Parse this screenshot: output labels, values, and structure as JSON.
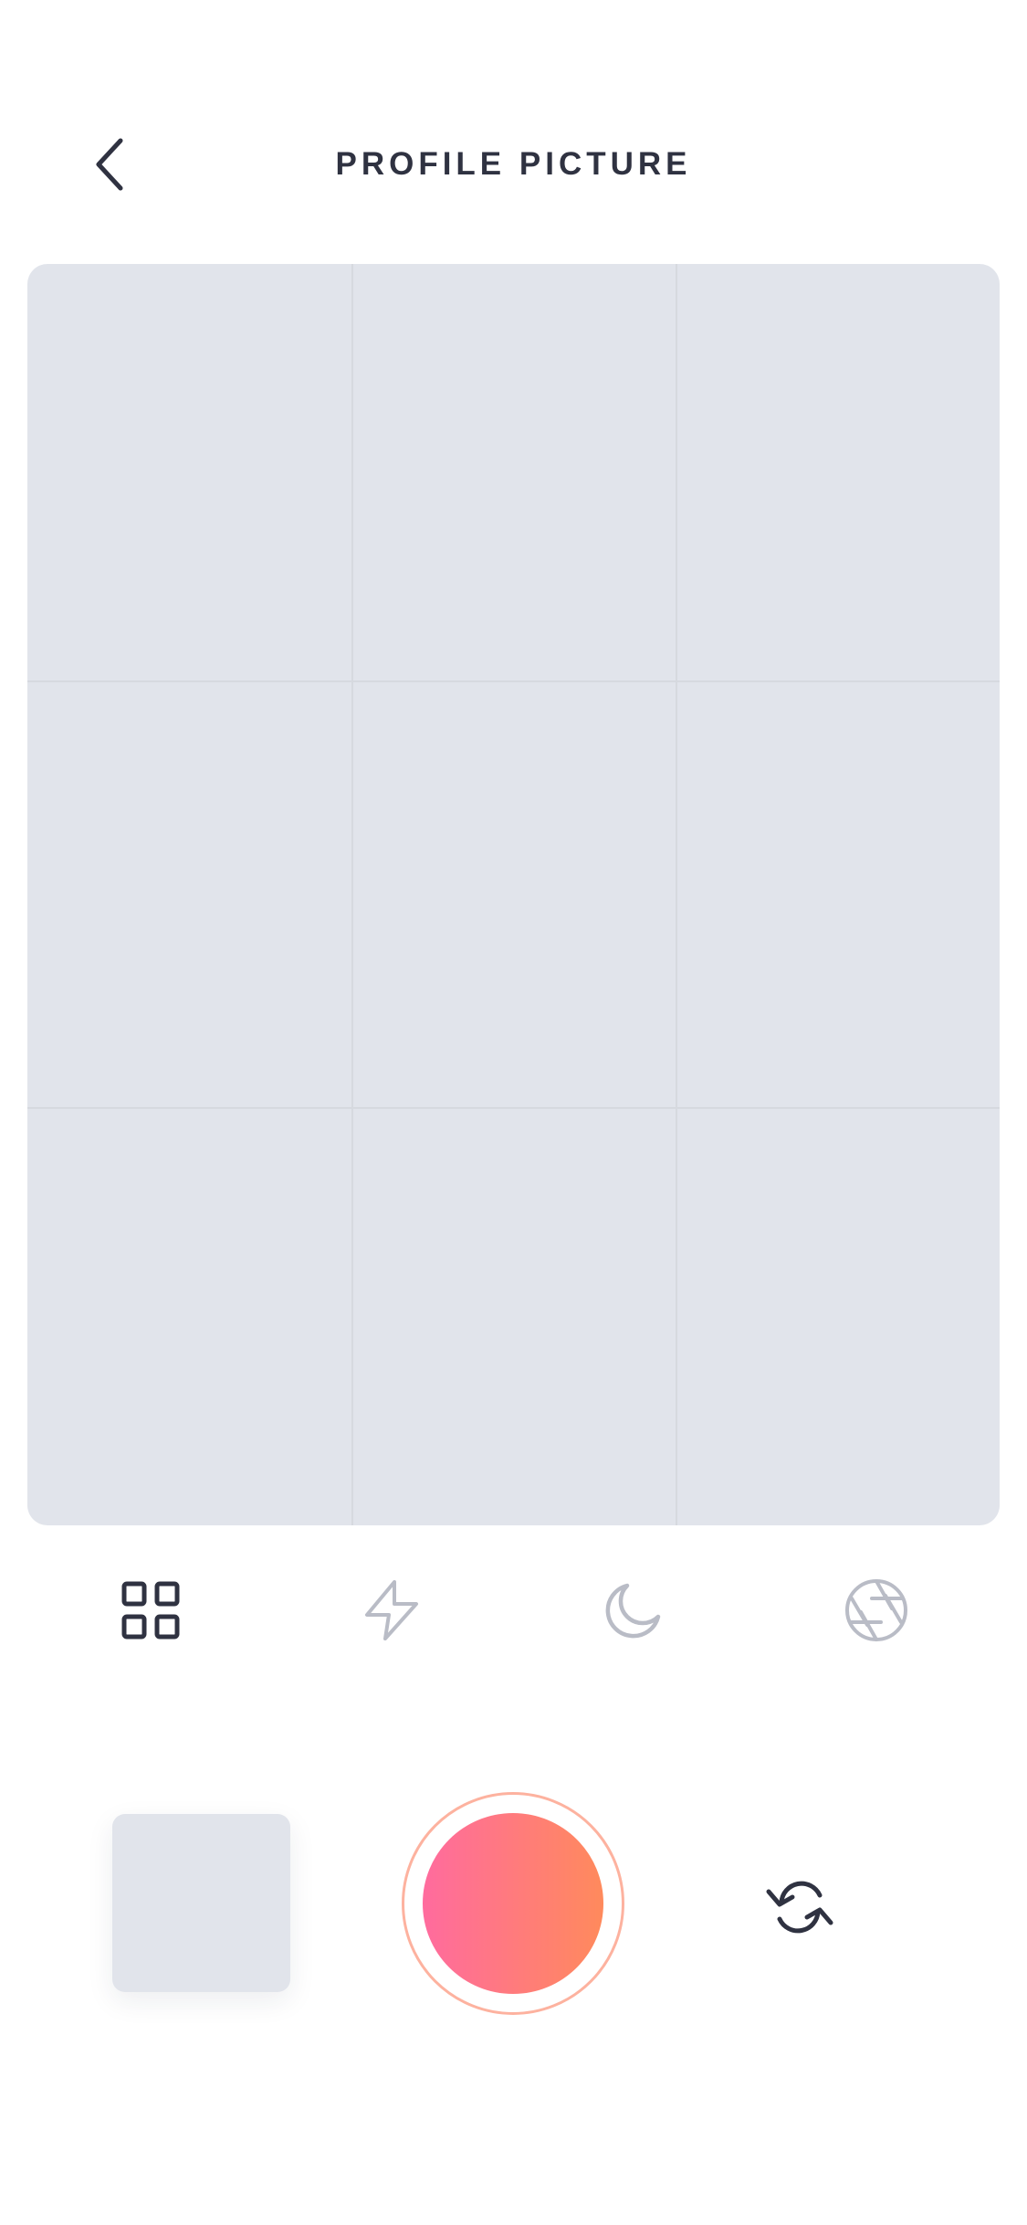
{
  "header": {
    "title": "PROFILE PICTURE",
    "back_icon": "chevron-left-icon"
  },
  "viewfinder": {
    "grid": "3x3"
  },
  "modes": [
    {
      "icon": "grid-icon",
      "active": true
    },
    {
      "icon": "flash-icon",
      "active": false
    },
    {
      "icon": "night-mode-icon",
      "active": false
    },
    {
      "icon": "aperture-icon",
      "active": false
    }
  ],
  "controls": {
    "gallery_icon": "gallery-thumbnail",
    "shutter_icon": "shutter-button",
    "flip_icon": "switch-camera-icon"
  },
  "colors": {
    "title_text": "#2f3241",
    "viewfinder_bg": "#e1e4eb",
    "active_icon": "#2f3241",
    "inactive_icon": "#b9bcc6",
    "shutter_gradient_start": "#ff6b9e",
    "shutter_gradient_end": "#ff8a5c",
    "shutter_ring": "#fdb29f"
  }
}
